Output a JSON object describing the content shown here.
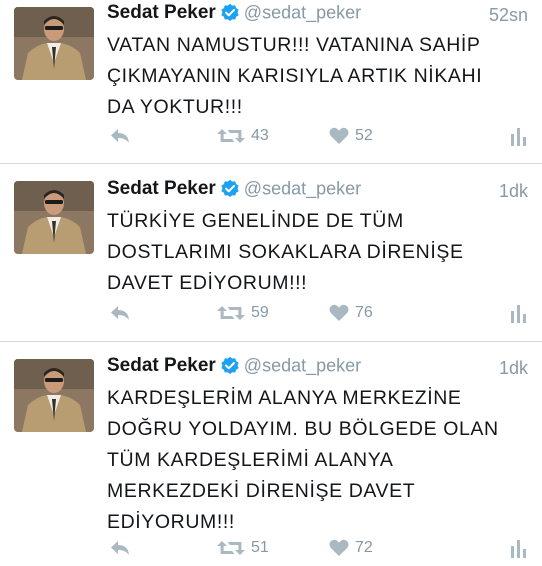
{
  "tweets": [
    {
      "author_name": "Sedat Peker",
      "handle": "@sedat_peker",
      "time": "52sn",
      "lines": [
        "VATAN NAMUSTUR!!! VATANINA SAHİP",
        "ÇIKMAYANIN KARISIYLA ARTIK NİKAHI",
        "DA YOKTUR!!!"
      ],
      "retweets": "43",
      "likes": "52"
    },
    {
      "author_name": "Sedat Peker",
      "handle": "@sedat_peker",
      "time": "1dk",
      "lines": [
        "TÜRKİYE GENELİNDE DE TÜM",
        "DOSTLARIMI SOKAKLARA  DİRENİŞE",
        "DAVET EDİYORUM!!!"
      ],
      "retweets": "59",
      "likes": "76"
    },
    {
      "author_name": "Sedat Peker",
      "handle": "@sedat_peker",
      "time": "1dk",
      "lines": [
        "KARDEŞLERİM ALANYA MERKEZİNE",
        "DOĞRU YOLDAYIM. BU BÖLGEDE OLAN",
        "TÜM KARDEŞLERİMİ ALANYA",
        "MERKEZDEKİ DİRENİŞE DAVET",
        "EDİYORUM!!!"
      ],
      "retweets": "51",
      "likes": "72"
    }
  ],
  "icons": {
    "verified": "verified-badge-icon",
    "reply": "reply-icon",
    "retweet": "retweet-icon",
    "like": "heart-icon",
    "analytics": "analytics-icon"
  },
  "colors": {
    "verified_blue": "#1da1f2",
    "action_gray": "#aab8c2",
    "meta_gray": "#8899a6",
    "divider": "#d6d9dc"
  }
}
